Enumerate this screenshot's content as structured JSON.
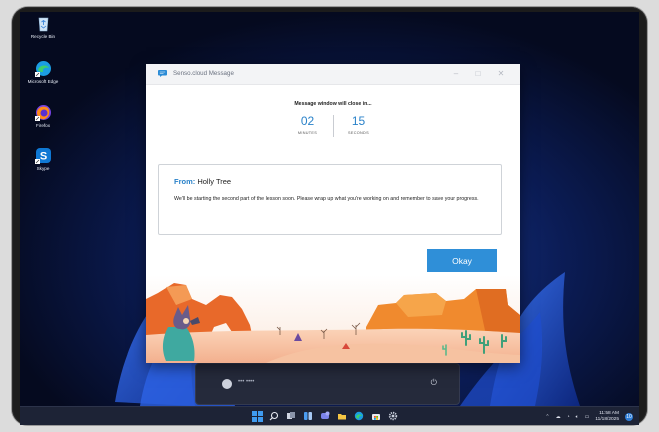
{
  "desktop": {
    "icons": [
      {
        "label": "Recycle Bin"
      },
      {
        "label": "Microsoft Edge"
      },
      {
        "label": "Firefox"
      },
      {
        "label": "Skype"
      }
    ]
  },
  "window": {
    "title": "Senso.cloud Message",
    "close_notice": "Message window will close in...",
    "countdown": {
      "minutes": "02",
      "minutes_label": "MINUTES",
      "seconds": "15",
      "seconds_label": "SECONDS"
    },
    "message": {
      "from_label": "From:",
      "sender": "Holly Tree",
      "body": "We'll be starting the second part of the lesson soon. Please wrap up what you're working on and remember to save your progress."
    },
    "okay_label": "Okay"
  },
  "flyout": {
    "user_name": "••• ••••"
  },
  "taskbar": {
    "time": "11:58 AM",
    "date": "11/18/2025",
    "notification_count": "10"
  },
  "colors": {
    "accent": "#2f8fd8",
    "countdown": "#2a82c9"
  }
}
